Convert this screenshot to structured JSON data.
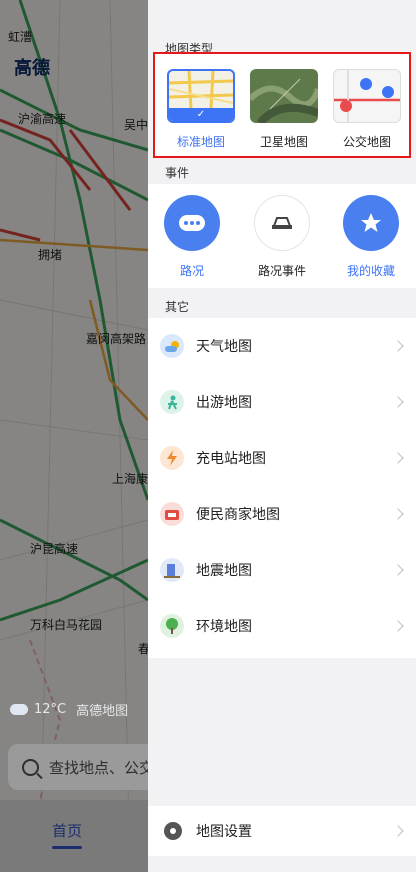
{
  "map": {
    "brand": "高德",
    "labels": [
      "虹漕",
      "沪渝高速",
      "吴中",
      "拥堵",
      "嘉闵高架路",
      "上海康",
      "沪昆高速",
      "万科白马花园",
      "春"
    ],
    "weather_temp": "12°C",
    "weather_source": "高德地图",
    "search_placeholder": "查找地点、公交",
    "home_tab": "首页"
  },
  "drawer": {
    "map_type_title": "地图类型",
    "map_types": [
      {
        "label": "标准地图",
        "selected": true
      },
      {
        "label": "卫星地图",
        "selected": false
      },
      {
        "label": "公交地图",
        "selected": false
      }
    ],
    "events_title": "事件",
    "events": [
      {
        "label": "路况",
        "icon": "traffic-dots-icon",
        "active": true
      },
      {
        "label": "路况事件",
        "icon": "car-incident-icon",
        "active": false
      },
      {
        "label": "我的收藏",
        "icon": "star-icon",
        "active": true
      }
    ],
    "other_title": "其它",
    "others": [
      {
        "label": "天气地图",
        "icon": "weather-icon",
        "color": "#6aa7ef"
      },
      {
        "label": "出游地图",
        "icon": "travel-icon",
        "color": "#3cb59a"
      },
      {
        "label": "充电站地图",
        "icon": "charging-icon",
        "color": "#f08a2e"
      },
      {
        "label": "便民商家地图",
        "icon": "shop-icon",
        "color": "#e24b40"
      },
      {
        "label": "地震地图",
        "icon": "earthquake-icon",
        "color": "#5b7fd8"
      },
      {
        "label": "环境地图",
        "icon": "tree-icon",
        "color": "#4caf50"
      }
    ],
    "settings_label": "地图设置"
  },
  "colors": {
    "accent": "#3d73f5",
    "highlight_border": "#e5191c"
  }
}
